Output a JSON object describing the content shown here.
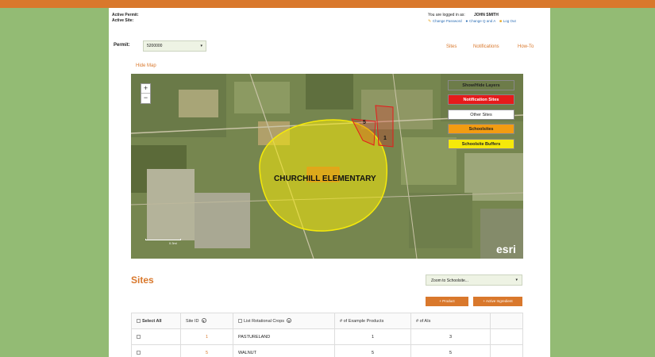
{
  "header": {
    "active_permit_label": "Active Permit:",
    "active_site_label": "Active Site:",
    "logged_in_label": "You are logged in as:",
    "user_name": "JOHN SMITH",
    "change_password": "Change Password",
    "change_qa": "Change Q and A",
    "log_out": "Log Out"
  },
  "permit": {
    "label": "Permit:",
    "value": "5200000",
    "caret": "▾"
  },
  "nav": {
    "tabs": [
      "Sites",
      "Notifications",
      "How-To"
    ]
  },
  "map": {
    "hide_map_link": "Hide Map",
    "zoom_in": "+",
    "zoom_out": "−",
    "label": "CHURCHILL ELEMENTARY",
    "site_labels": [
      "5",
      "1"
    ],
    "scale_label": "0.3mi",
    "esri": "esri",
    "layers": [
      {
        "label": "Show/Hide Layers",
        "bg": "#ffffff",
        "fg": "#222222"
      },
      {
        "label": "Notification Sites",
        "bg": "#e51b1b",
        "fg": "#ffffff"
      },
      {
        "label": "Other Sites",
        "bg": "#ffffff",
        "fg": "#222222"
      },
      {
        "label": "Schoolsites",
        "bg": "#f39c12",
        "fg": "#222222"
      },
      {
        "label": "Schoolsite Buffers",
        "bg": "#f5e90a",
        "fg": "#222222"
      }
    ]
  },
  "sites": {
    "title": "Sites",
    "zoom_select": "Zoom to Schoolsite...",
    "zoom_caret": "▾",
    "add_product": "+ Product",
    "add_active": "+ Active Ingredient",
    "table": {
      "headers": {
        "select_all": "Select All",
        "site_id": "Site ID",
        "list_crops": "List Rotational Crops",
        "example_products": "# of Example Products",
        "ais": "# of AIs"
      },
      "rows": [
        {
          "id": "1",
          "crop": "PASTURELAND",
          "products": "1",
          "ais": "3"
        },
        {
          "id": "5",
          "crop": "WALNUT",
          "products": "5",
          "ais": "5"
        }
      ]
    }
  },
  "colors": {
    "accent": "#d9782c",
    "background": "#93bb74"
  }
}
